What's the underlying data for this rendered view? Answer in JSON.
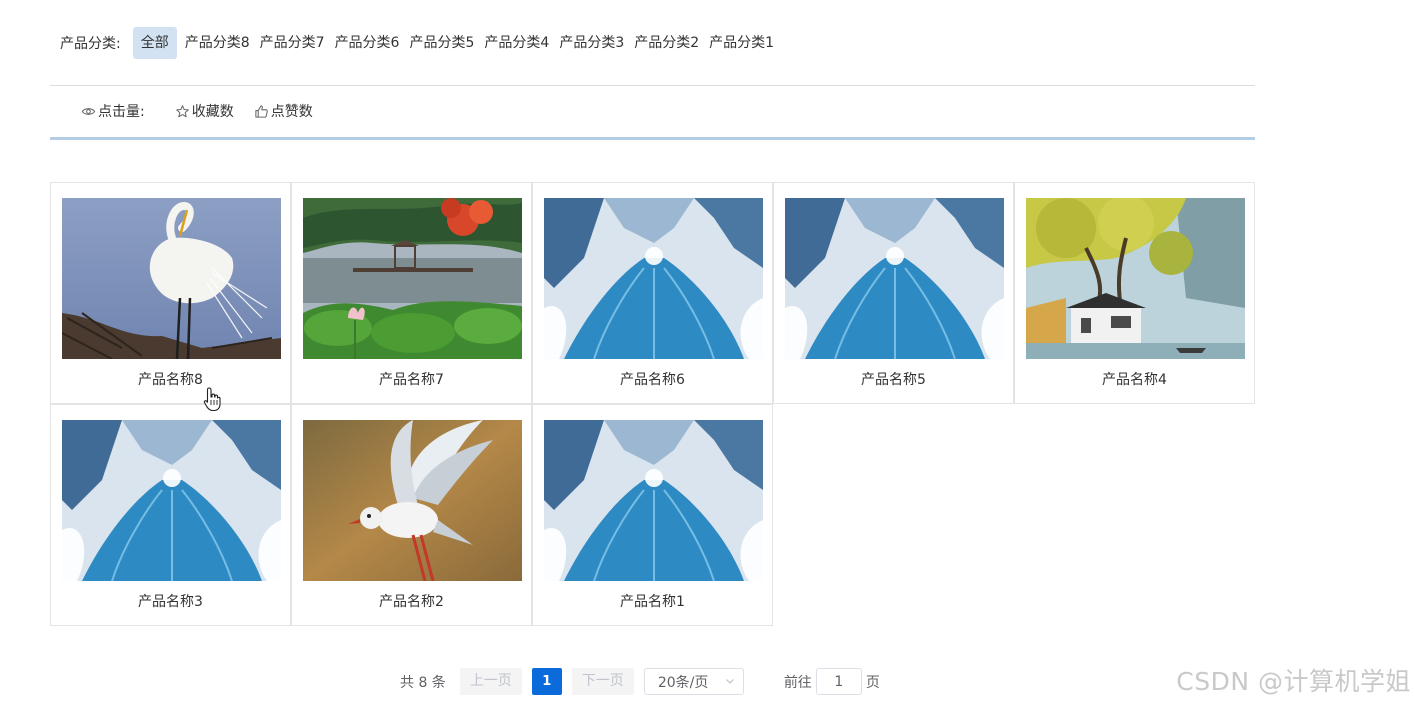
{
  "category_bar": {
    "label": "产品分类:",
    "items": [
      "全部",
      "产品分类8",
      "产品分类7",
      "产品分类6",
      "产品分类5",
      "产品分类4",
      "产品分类3",
      "产品分类2",
      "产品分类1"
    ],
    "active_index": 0
  },
  "sort_bar": {
    "label": "点击量:",
    "label_icon": "eye-icon",
    "items": [
      {
        "label": "收藏数",
        "icon": "star-icon"
      },
      {
        "label": "点赞数",
        "icon": "thumbs-up-icon"
      }
    ]
  },
  "products": [
    {
      "name": "产品名称8",
      "image": "egret"
    },
    {
      "name": "产品名称7",
      "image": "lotus-pond"
    },
    {
      "name": "产品名称6",
      "image": "blue-art"
    },
    {
      "name": "产品名称5",
      "image": "blue-art"
    },
    {
      "name": "产品名称4",
      "image": "lakeside-house"
    },
    {
      "name": "产品名称3",
      "image": "blue-art"
    },
    {
      "name": "产品名称2",
      "image": "seagull"
    },
    {
      "name": "产品名称1",
      "image": "blue-art"
    }
  ],
  "pagination": {
    "total_text": "共 8 条",
    "prev_label": "上一页",
    "current_page": "1",
    "next_label": "下一页",
    "page_size": "20条/页",
    "goto_label": "前往",
    "goto_value": "1",
    "goto_suffix": "页"
  },
  "watermark": "CSDN @计算机学姐",
  "colors": {
    "active_category_bg": "#d2e2f3",
    "accent_divider": "#b3cde4",
    "current_page_bg": "#0b6bdb"
  }
}
